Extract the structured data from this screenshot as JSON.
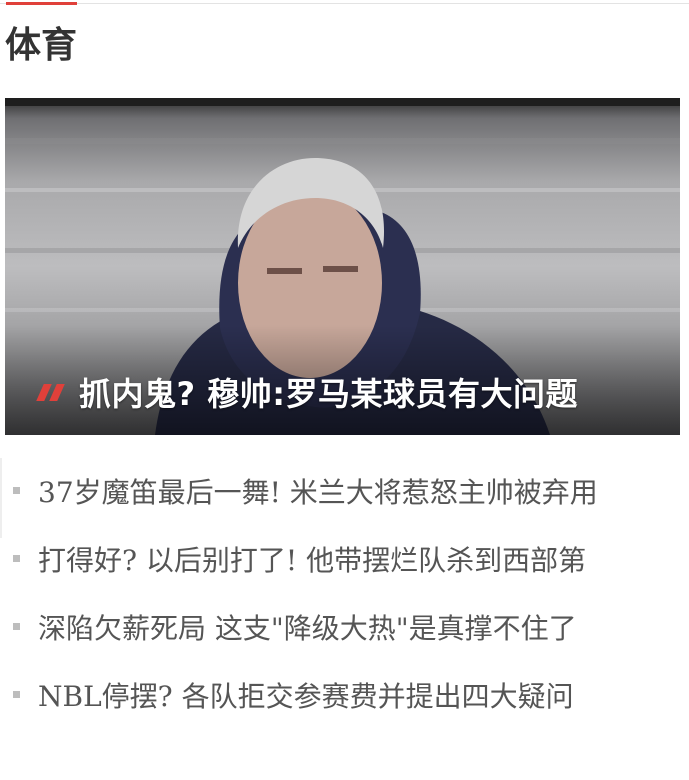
{
  "section": {
    "title": "体育"
  },
  "hero": {
    "caption": "抓内鬼? 穆帅:罗马某球员有大问题"
  },
  "news": {
    "items": [
      {
        "text": "37岁魔笛最后一舞! 米兰大将惹怒主帅被弃用"
      },
      {
        "text": "打得好? 以后别打了! 他带摆烂队杀到西部第"
      },
      {
        "text": "深陷欠薪死局 这支\"降级大热\"是真撑不住了"
      },
      {
        "text": "NBL停摆? 各队拒交参赛费并提出四大疑问"
      }
    ]
  },
  "colors": {
    "accent": "#e0403a",
    "title": "#333333",
    "list_text": "#555555",
    "bullet": "#bdbdbd"
  }
}
